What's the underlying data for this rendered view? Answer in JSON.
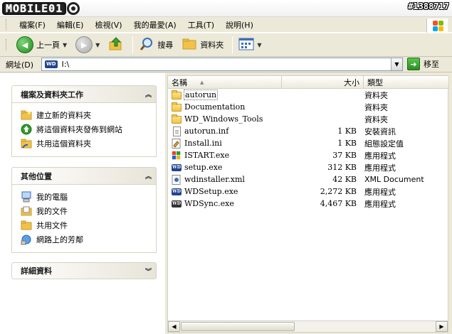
{
  "watermark": "#1388717",
  "logo": {
    "text": "MOBILE01"
  },
  "menu": [
    {
      "label": "檔案(F)"
    },
    {
      "label": "編輯(E)"
    },
    {
      "label": "檢視(V)"
    },
    {
      "label": "我的最愛(A)"
    },
    {
      "label": "工具(T)"
    },
    {
      "label": "說明(H)"
    }
  ],
  "toolbar": {
    "back_label": "上一頁",
    "search_label": "搜尋",
    "folders_label": "資料夾"
  },
  "address": {
    "label": "網址(D)",
    "value": "I:\\",
    "go_label": "移至"
  },
  "left": {
    "tasks": {
      "title": "檔案及資料夾工作",
      "items": [
        {
          "label": "建立新的資料夾"
        },
        {
          "label": "將這個資料夾發佈到網站"
        },
        {
          "label": "共用這個資料夾"
        }
      ]
    },
    "places": {
      "title": "其他位置",
      "items": [
        {
          "label": "我的電腦"
        },
        {
          "label": "我的文件"
        },
        {
          "label": "共用文件"
        },
        {
          "label": "網路上的芳鄰"
        }
      ]
    },
    "details": {
      "title": "詳細資料"
    }
  },
  "columns": {
    "name": "名稱",
    "size": "大小",
    "type": "類型"
  },
  "files": [
    {
      "name": "autorun",
      "size": "",
      "type": "資料夾",
      "icon": "folder-icon"
    },
    {
      "name": "Documentation",
      "size": "",
      "type": "資料夾",
      "icon": "folder-icon"
    },
    {
      "name": "WD_Windows_Tools",
      "size": "",
      "type": "資料夾",
      "icon": "folder-icon"
    },
    {
      "name": "autorun.inf",
      "size": "1 KB",
      "type": "安裝資訊",
      "icon": "inf-file-icon"
    },
    {
      "name": "Install.ini",
      "size": "1 KB",
      "type": "組態設定值",
      "icon": "ini-file-icon"
    },
    {
      "name": "ISTART.exe",
      "size": "37 KB",
      "type": "應用程式",
      "icon": "istart-app-icon"
    },
    {
      "name": "setup.exe",
      "size": "312 KB",
      "type": "應用程式",
      "icon": "wd-app-icon"
    },
    {
      "name": "wdinstaller.xml",
      "size": "42 KB",
      "type": "XML Document",
      "icon": "xml-file-icon"
    },
    {
      "name": "WDSetup.exe",
      "size": "2,272 KB",
      "type": "應用程式",
      "icon": "wd-app-icon"
    },
    {
      "name": "WDSync.exe",
      "size": "4,467 KB",
      "type": "應用程式",
      "icon": "wd-sync-icon"
    }
  ]
}
